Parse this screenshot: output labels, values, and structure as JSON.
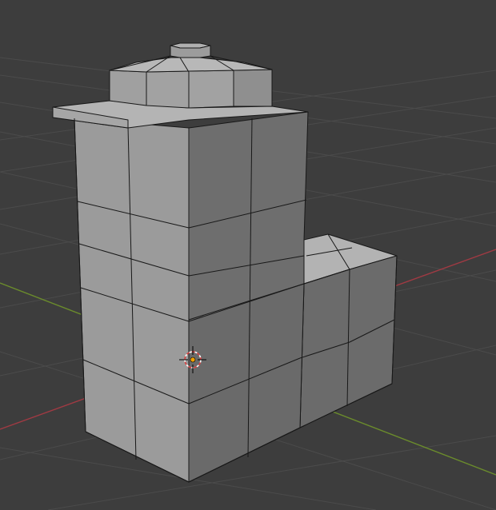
{
  "viewport": {
    "background": "#3d3d3d",
    "grid_color": "#4d4d4d",
    "x_axis_color": "#a03a43",
    "y_axis_color": "#6b8c2c",
    "mesh_edge_color": "#181818"
  },
  "scene": {
    "object_type": "mesh",
    "shading": "solid",
    "face_colors": {
      "front": "#9d9d9d",
      "side": "#6e6e6e",
      "top": "#b5b5b5"
    },
    "cursor_icon": "3d-cursor-icon"
  }
}
